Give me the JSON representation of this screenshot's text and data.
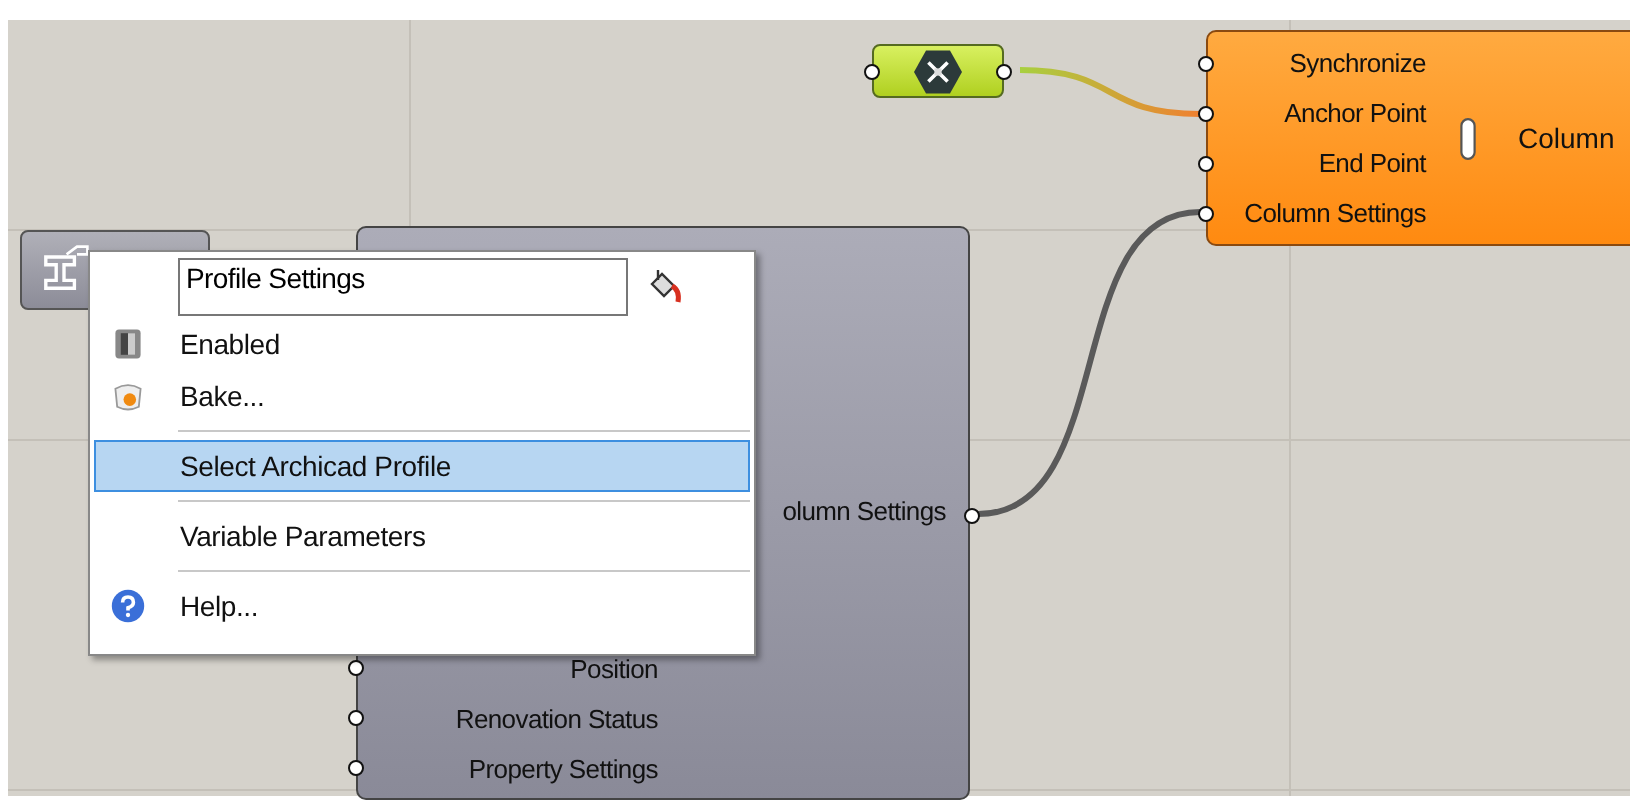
{
  "canvas": {
    "param_node": {
      "kind": "hexagon"
    },
    "column_node": {
      "inputs": [
        "Synchronize",
        "Anchor Point",
        "End Point",
        "Column Settings"
      ],
      "name": "Column"
    },
    "profile_node": {
      "output": "olumn Settings",
      "inputs": [
        "Position",
        "Renovation Status",
        "Property Settings"
      ]
    },
    "context_menu": {
      "name_field": {
        "value": "Profile Settings"
      },
      "items": [
        {
          "kind": "toggle",
          "label": "Enabled",
          "selected": false,
          "separator_before": false
        },
        {
          "kind": "bake",
          "label": "Bake...",
          "selected": false,
          "separator_before": false
        },
        {
          "kind": "plain",
          "label": "Select Archicad Profile",
          "selected": true,
          "separator_before": true
        },
        {
          "kind": "plain",
          "label": "Variable Parameters",
          "selected": false,
          "separator_before": true
        },
        {
          "kind": "help",
          "label": "Help...",
          "selected": false,
          "separator_before": true
        }
      ]
    }
  }
}
